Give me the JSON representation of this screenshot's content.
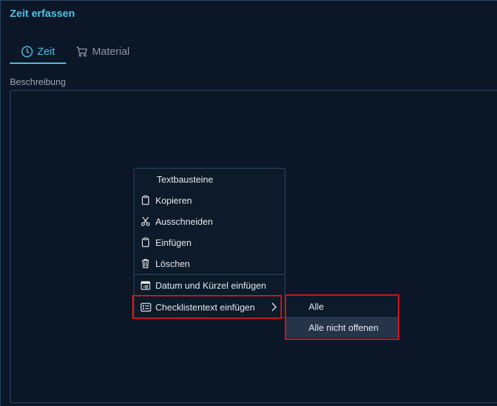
{
  "dialog": {
    "title": "Zeit erfassen",
    "tabs": [
      {
        "label": "Zeit",
        "icon": "clock-icon",
        "active": true
      },
      {
        "label": "Material",
        "icon": "cart-icon",
        "active": false
      }
    ]
  },
  "form": {
    "description_label": "Beschreibung"
  },
  "context_menu": {
    "items": [
      {
        "label": "Textbausteine",
        "icon": ""
      },
      {
        "label": "Kopieren",
        "icon": "clipboard-icon"
      },
      {
        "label": "Ausschneiden",
        "icon": "scissors-icon"
      },
      {
        "label": "Einfügen",
        "icon": "clipboard-icon"
      },
      {
        "label": "Löschen",
        "icon": "trash-icon"
      },
      {
        "label": "Datum und Kürzel einfügen",
        "icon": "calendar-icon"
      },
      {
        "label": "Checklistentext einfügen",
        "icon": "checklist-icon"
      }
    ],
    "submenu": [
      {
        "label": "Alle"
      },
      {
        "label": "Alle nicht offenen"
      }
    ]
  },
  "colors": {
    "accent": "#4ec3ea",
    "background": "#0b1726",
    "highlight": "#d0161b"
  }
}
